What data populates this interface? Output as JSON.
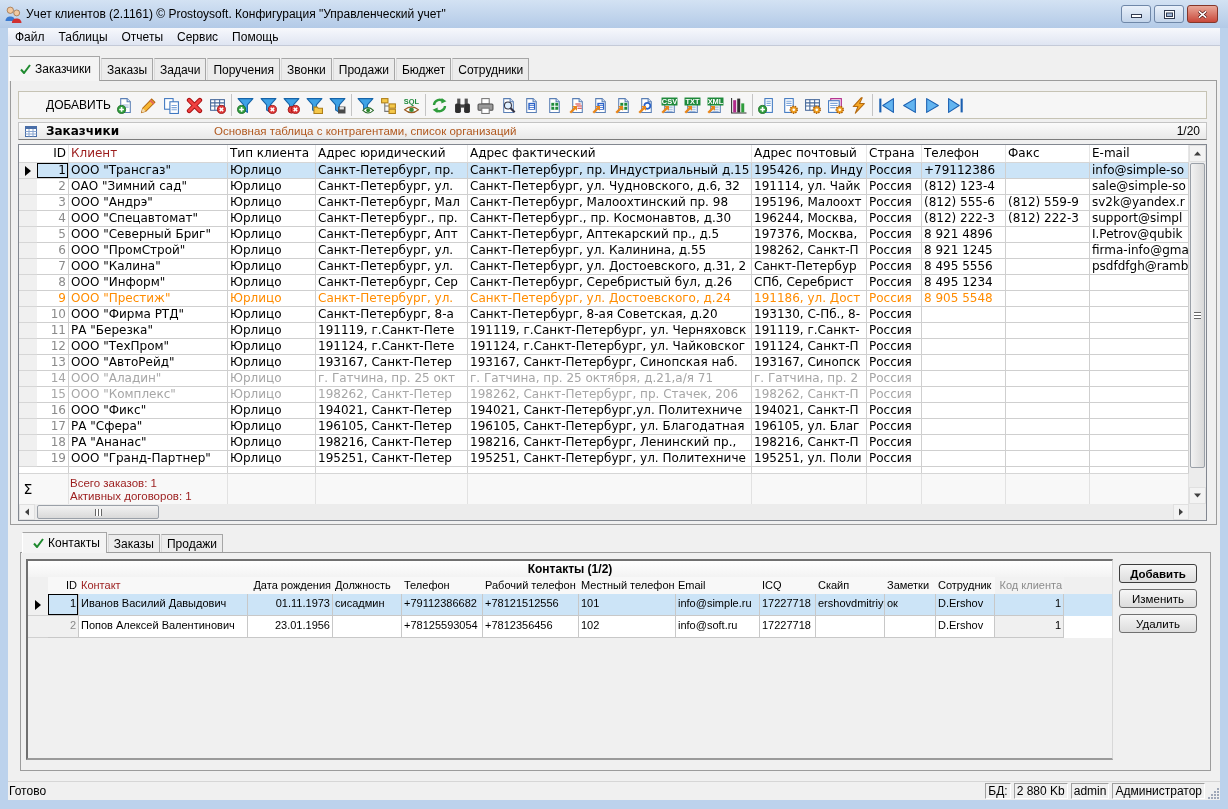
{
  "window": {
    "title": "Учет клиентов (2.1161) © Prostoysoft. Конфигурация \"Управленческий учет\""
  },
  "menu": [
    "Файл",
    "Таблицы",
    "Отчеты",
    "Сервис",
    "Помощь"
  ],
  "tabs": [
    {
      "label": "Заказчики",
      "selected": true
    },
    {
      "label": "Заказы",
      "selected": false
    },
    {
      "label": "Задачи",
      "selected": false
    },
    {
      "label": "Поручения",
      "selected": false
    },
    {
      "label": "Звонки",
      "selected": false
    },
    {
      "label": "Продажи",
      "selected": false
    },
    {
      "label": "Бюджет",
      "selected": false
    },
    {
      "label": "Сотрудники",
      "selected": false
    }
  ],
  "toolbar": {
    "add_button": "ДОБАВИТЬ",
    "badges": [
      "SQL",
      "CSV",
      "TXT",
      "XML"
    ]
  },
  "table_header": {
    "title": "Заказчики",
    "description": "Основная таблица с контрагентами, список организаций",
    "counter": "1/20"
  },
  "table": {
    "columns": [
      {
        "label": "ID",
        "highlighted": false
      },
      {
        "label": "Клиент",
        "highlighted": true
      },
      {
        "label": "Тип клиента",
        "highlighted": false
      },
      {
        "label": "Адрес юридический",
        "highlighted": false
      },
      {
        "label": "Адрес фактический",
        "highlighted": false
      },
      {
        "label": "Адрес почтовый",
        "highlighted": false
      },
      {
        "label": "Страна",
        "highlighted": false
      },
      {
        "label": "Телефон",
        "highlighted": false
      },
      {
        "label": "Факс",
        "highlighted": false
      },
      {
        "label": "E-mail",
        "highlighted": false
      }
    ],
    "rows": [
      {
        "cells": [
          "1",
          "ООО \"Трансгаз\"",
          "Юрлицо",
          "Санкт-Петербург, пр.",
          "Санкт-Петербург, пр. Индустриальный д.15",
          "195426, пр. Инду",
          "Россия",
          "+79112386",
          null,
          "info@simple-so"
        ],
        "selected": true,
        "highlighted": false,
        "disabled": false
      },
      {
        "cells": [
          "2",
          "ОАО \"Зимний сад\"",
          "Юрлицо",
          "Санкт-Петербург, ул.",
          "Санкт-Петербург, ул. Чудновского, д.6, 32",
          "191114, ул. Чайк",
          "Россия",
          "(812) 123-4",
          null,
          "sale@simple-so"
        ],
        "selected": false,
        "highlighted": false,
        "disabled": false
      },
      {
        "cells": [
          "3",
          "ООО \"Андрэ\"",
          "Юрлицо",
          "Санкт-Петербург, Мал",
          "Санкт-Петербург, Малоохтинский пр. 98",
          "195196, Малоохт",
          "Россия",
          "(812) 555-6",
          "(812) 559-9",
          "sv2k@yandex.r"
        ],
        "selected": false,
        "highlighted": false,
        "disabled": false
      },
      {
        "cells": [
          "4",
          "ООО \"Спецавтомат\"",
          "Юрлицо",
          "Санкт-Петербург., пр.",
          "Санкт-Петербург., пр. Космонавтов, д.30",
          "196244, Москва,",
          "Россия",
          "(812) 222-3",
          "(812) 222-3",
          "support@simpl"
        ],
        "selected": false,
        "highlighted": false,
        "disabled": false
      },
      {
        "cells": [
          "5",
          "ООО \"Северный Бриг\"",
          "Юрлицо",
          "Санкт-Петербург, Апт",
          "Санкт-Петербург, Аптекарский пр., д.5",
          "197376, Москва,",
          "Россия",
          "8 921 4896",
          null,
          "I.Petrov@qubik"
        ],
        "selected": false,
        "highlighted": false,
        "disabled": false
      },
      {
        "cells": [
          "6",
          "ООО \"ПромСтрой\"",
          "Юрлицо",
          "Санкт-Петербург, ул.",
          "Санкт-Петербург, ул. Калинина, д.55",
          "198262, Санкт-П",
          "Россия",
          "8 921 1245",
          null,
          "firma-info@gma"
        ],
        "selected": false,
        "highlighted": false,
        "disabled": false
      },
      {
        "cells": [
          "7",
          "ООО \"Калина\"",
          "Юрлицо",
          "Санкт-Петербург, ул.",
          "Санкт-Петербург, ул. Достоевского, д.31, 2",
          "Санкт-Петербур",
          "Россия",
          "8 495 5556",
          null,
          "psdfdfgh@ramb"
        ],
        "selected": false,
        "highlighted": false,
        "disabled": false
      },
      {
        "cells": [
          "8",
          "ООО \"Информ\"",
          "Юрлицо",
          "Санкт-Петербург, Сер",
          "Санкт-Петербург, Серебристый бул, д.26",
          "СПб, Серебрист",
          "Россия",
          "8 495 1234"
        ],
        "selected": false,
        "highlighted": false,
        "disabled": false
      },
      {
        "cells": [
          "9",
          "ООО \"Престиж\"",
          "Юрлицо",
          "Санкт-Петербург, ул.",
          "Санкт-Петербург, ул. Достоевского, д.24",
          "191186, ул. Дост",
          "Россия",
          "8 905 5548"
        ],
        "selected": false,
        "highlighted": true,
        "disabled": false
      },
      {
        "cells": [
          "10",
          "ООО \"Фирма РТД\"",
          "Юрлицо",
          "Санкт-Петербург, 8-а",
          "Санкт-Петербург, 8-ая Советская, д.20",
          "193130, С-Пб., 8-",
          "Россия"
        ],
        "selected": false,
        "highlighted": false,
        "disabled": false
      },
      {
        "cells": [
          "11",
          "РА \"Березка\"",
          "Юрлицо",
          "191119, г.Санкт-Пете",
          "191119, г.Санкт-Петербург, ул. Черняховск",
          "191119, г.Санкт-",
          "Россия"
        ],
        "selected": false,
        "highlighted": false,
        "disabled": false
      },
      {
        "cells": [
          "12",
          "ООО \"ТехПром\"",
          "Юрлицо",
          "191124, г.Санкт-Пете",
          "191124, г.Санкт-Петербург, ул. Чайковског",
          "191124, Санкт-П",
          "Россия"
        ],
        "selected": false,
        "highlighted": false,
        "disabled": false
      },
      {
        "cells": [
          "13",
          "ООО \"АвтоРейд\"",
          "Юрлицо",
          "193167, Санкт-Петер",
          "193167, Санкт-Петербург, Синопская наб.",
          "193167, Синопск",
          "Россия"
        ],
        "selected": false,
        "highlighted": false,
        "disabled": false
      },
      {
        "cells": [
          "14",
          "ООО \"Аладин\"",
          "Юрлицо",
          "г. Гатчина, пр. 25 окт",
          "г. Гатчина, пр. 25 октября, д.21,а/я 71",
          "г. Гатчина, пр. 2",
          "Россия"
        ],
        "selected": false,
        "highlighted": false,
        "disabled": true
      },
      {
        "cells": [
          "15",
          "ООО \"Комплекс\"",
          "Юрлицо",
          "198262, Санкт-Петер",
          "198262, Санкт-Петербург, пр. Стачек, 206",
          "198262, Санкт-П",
          "Россия"
        ],
        "selected": false,
        "highlighted": false,
        "disabled": true
      },
      {
        "cells": [
          "16",
          "ООО \"Фикс\"",
          "Юрлицо",
          "194021, Санкт-Петер",
          "194021, Санкт-Петербург,ул. Политехниче",
          "194021, Санкт-П",
          "Россия"
        ],
        "selected": false,
        "highlighted": false,
        "disabled": false
      },
      {
        "cells": [
          "17",
          "РА \"Сфера\"",
          "Юрлицо",
          "196105, Санкт-Петер",
          "196105, Санкт-Петербург, ул. Благодатная",
          "196105, ул. Благ",
          "Россия"
        ],
        "selected": false,
        "highlighted": false,
        "disabled": false
      },
      {
        "cells": [
          "18",
          "РА \"Ананас\"",
          "Юрлицо",
          "198216, Санкт-Петер",
          "198216, Санкт-Петербург, Ленинский пр.,",
          "198216, Санкт-П",
          "Россия"
        ],
        "selected": false,
        "highlighted": false,
        "disabled": false
      },
      {
        "cells": [
          "19",
          "ООО \"Гранд-Партнер\"",
          "Юрлицо",
          "195251, Санкт-Петер",
          "195251, Санкт-Петербург, ул. Политехниче",
          "195251, ул. Поли",
          "Россия"
        ],
        "selected": false,
        "highlighted": false,
        "disabled": false
      }
    ],
    "footer": {
      "symbol": "Σ",
      "lines": [
        "Всего заказов: 1",
        "Активных договоров: 1"
      ]
    }
  },
  "detail_tabs": [
    {
      "label": "Контакты",
      "selected": true
    },
    {
      "label": "Заказы",
      "selected": false
    },
    {
      "label": "Продажи",
      "selected": false
    }
  ],
  "contacts": {
    "title": "Контакты (1/2)",
    "columns": [
      {
        "label": "ID",
        "highlighted": false,
        "disabled": false
      },
      {
        "label": "Контакт",
        "highlighted": true,
        "disabled": false
      },
      {
        "label": "Дата рождения",
        "highlighted": false,
        "disabled": false
      },
      {
        "label": "Должность",
        "highlighted": false,
        "disabled": false
      },
      {
        "label": "Телефон",
        "highlighted": false,
        "disabled": false
      },
      {
        "label": "Рабочий телефон",
        "highlighted": false,
        "disabled": false
      },
      {
        "label": "Местный телефон",
        "highlighted": false,
        "disabled": false
      },
      {
        "label": "Email",
        "highlighted": false,
        "disabled": false
      },
      {
        "label": "ICQ",
        "highlighted": false,
        "disabled": false
      },
      {
        "label": "Скайп",
        "highlighted": false,
        "disabled": false
      },
      {
        "label": "Заметки",
        "highlighted": false,
        "disabled": false
      },
      {
        "label": "Сотрудник",
        "highlighted": false,
        "disabled": false
      },
      {
        "label": "Код клиента",
        "highlighted": false,
        "disabled": true
      }
    ],
    "rows": [
      {
        "cells": [
          "1",
          "Иванов Василий Давыдович",
          "01.11.1973",
          "сисадмин",
          "+79112386682",
          "+78121512556",
          "101",
          "info@simple.ru",
          "17227718",
          "ershovdmitriy",
          "ок",
          "D.Ershov",
          "1"
        ],
        "selected": true
      },
      {
        "cells": [
          "2",
          "Попов Алексей Валентинович",
          "23.01.1956",
          null,
          "+78125593054",
          "+7812356456",
          "102",
          "info@soft.ru",
          "17227718",
          null,
          null,
          "D.Ershov",
          "1"
        ],
        "selected": false
      }
    ]
  },
  "contact_buttons": [
    {
      "label": "Добавить",
      "default": true
    },
    {
      "label": "Изменить",
      "default": false
    },
    {
      "label": "Удалить",
      "default": false
    }
  ],
  "status_bar": {
    "text": "Готово",
    "panels": [
      "БД:",
      "2 880 Kb",
      "admin",
      "Администратор"
    ]
  }
}
